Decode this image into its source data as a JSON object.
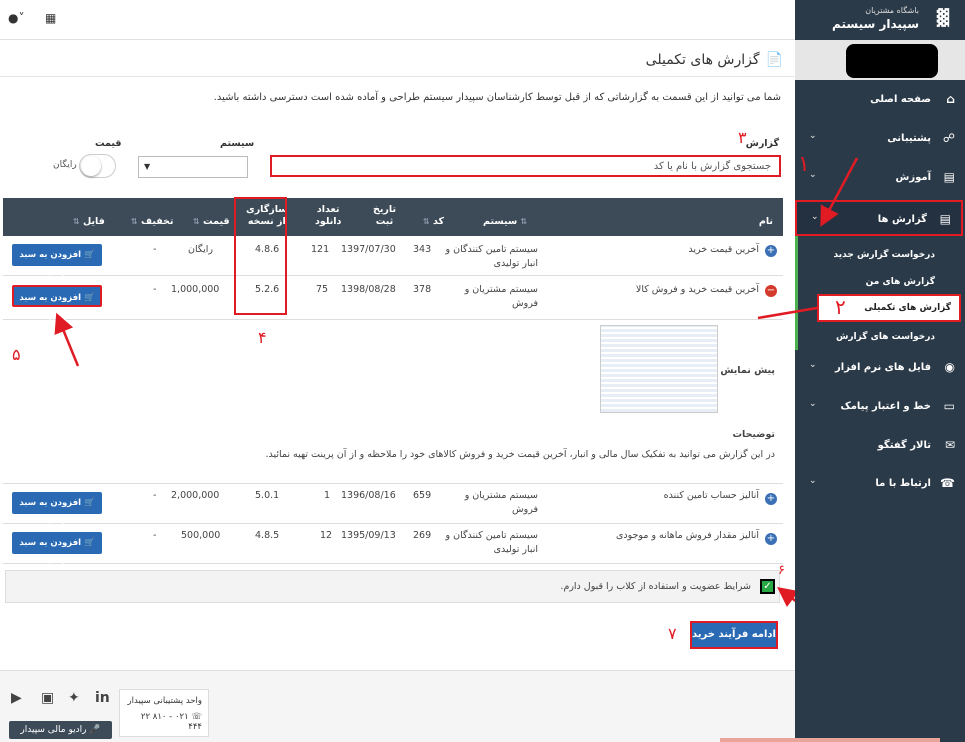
{
  "brand": {
    "line1": "باشگاه مشتریان",
    "line2": "سپیدار سیستم"
  },
  "page": {
    "title": "گزارش های تکمیلی",
    "intro": "شما می توانید از این قسمت به گزارشاتی که از قبل توسط کارشناسان سپیدار سیستم طراحی و آماده شده است دسترسی داشته باشید."
  },
  "filters": {
    "report_label": "گزارش",
    "system_label": "سیستم",
    "price_label": "قیمت",
    "search_placeholder": "جستجوی گزارش با نام یا کد",
    "free_label": "رایگان"
  },
  "table": {
    "headers": {
      "name": "نام",
      "system": "سیستم",
      "code": "کد",
      "reg_date_1": "تاریخ",
      "reg_date_2": "ثبت",
      "downloads_1": "تعداد",
      "downloads_2": "دانلود",
      "compat_1": "سازگاری",
      "compat_2": "از نسخه",
      "price": "قیمت",
      "discount": "تخفیف",
      "file": "فایل"
    },
    "rows": [
      {
        "name": "آخرین قیمت خرید",
        "system_1": "سیستم تامین کنندگان و",
        "system_2": "انبار تولیدی",
        "code": "343",
        "date": "1397/07/30",
        "downloads": "121",
        "compat": "4.8.6",
        "price": "رایگان",
        "discount": "-"
      },
      {
        "name": "آخرین قیمت خرید و فروش کالا",
        "system_1": "سیستم مشتریان و",
        "system_2": "فروش",
        "code": "378",
        "date": "1398/08/28",
        "downloads": "75",
        "compat": "5.2.6",
        "price": "1,000,000",
        "discount": "-"
      },
      {
        "name": "آنالیز حساب تامین کننده",
        "system_1": "سیستم مشتریان و",
        "system_2": "فروش",
        "code": "659",
        "date": "1396/08/16",
        "downloads": "1",
        "compat": "5.0.1",
        "price": "2,000,000",
        "discount": "-"
      },
      {
        "name": "آنالیز مقدار فروش ماهانه و موجودی",
        "system_1": "سیستم تامین کنندگان و",
        "system_2": "انبار تولیدی",
        "code": "269",
        "date": "1395/09/13",
        "downloads": "12",
        "compat": "4.8.5",
        "price": "500,000",
        "discount": "-"
      }
    ],
    "add_to_cart": "افزودن به سبد خرید"
  },
  "detail": {
    "preview_label": "پیش نمایش",
    "desc_label": "توضیحات",
    "desc_text": "در این گزارش می توانید به تفکیک سال مالی و انبار، آخرین قیمت خرید و فروش کالاهای خود را ملاحظه و از آن پرینت تهیه نمائید."
  },
  "consent": {
    "text": "شرایط عضویت و استفاده از کلاب را قبول دارم."
  },
  "continue_label": "ادامه فرآیند خرید",
  "footer": {
    "radio": "رادیو مالی سپیدار",
    "support_title": "واحد پشتیبانی سپیدار",
    "support_phone": "۰۲۱ - ۸۱۰ ۲۲ ۴۴۴"
  },
  "sidebar": {
    "items": [
      {
        "label": "صفحه اصلی"
      },
      {
        "label": "پشتیبانی"
      },
      {
        "label": "آموزش"
      },
      {
        "label": "گزارش ها"
      },
      {
        "label": "فایل های نرم افزار"
      },
      {
        "label": "خط و اعتبار پیامک"
      },
      {
        "label": "تالار گفتگو"
      },
      {
        "label": "ارتباط با ما"
      }
    ],
    "sub_items": [
      {
        "label": "درخواست گزارش جدید"
      },
      {
        "label": "گزارش های من"
      },
      {
        "label": "گزارش های تکمیلی"
      },
      {
        "label": "درخواست های گزارش"
      }
    ]
  },
  "annotations": {
    "n1": "۱",
    "n2": "۲",
    "n3": "۳",
    "n4": "۴",
    "n5": "۵",
    "n6": "۶",
    "n7": "۷"
  },
  "colors": {
    "accent": "#2a6ab5",
    "annotation": "#e01b24",
    "sidebar": "#2b3a48",
    "header": "#3d4b59"
  }
}
